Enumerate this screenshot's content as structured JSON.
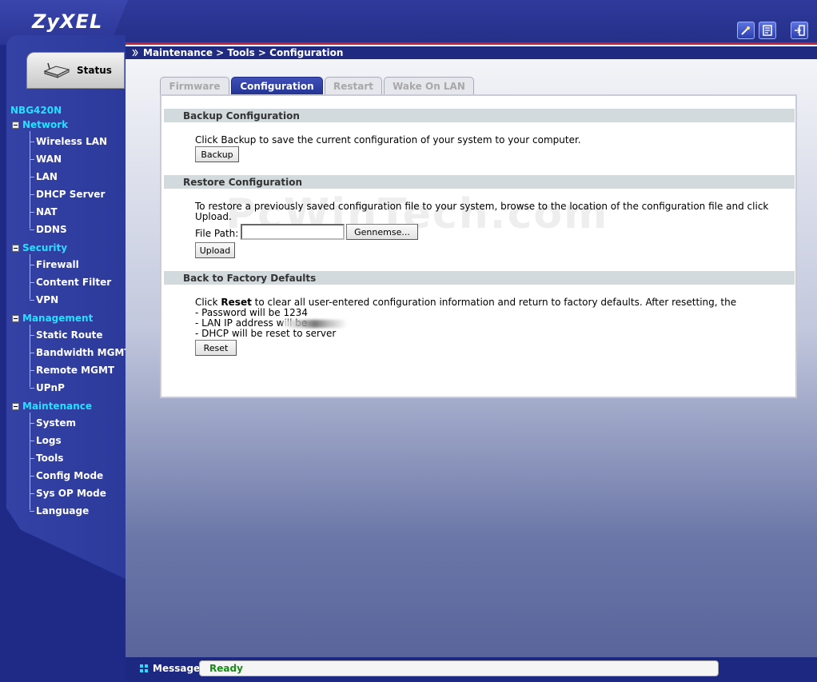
{
  "header": {
    "logo": "ZyXEL",
    "icons": [
      "wizard-icon",
      "about-icon",
      "logout-icon"
    ]
  },
  "sidebar": {
    "status_tab": "Status",
    "device": "NBG420N",
    "groups": [
      {
        "label": "Network",
        "items": [
          "Wireless LAN",
          "WAN",
          "LAN",
          "DHCP Server",
          "NAT",
          "DDNS"
        ]
      },
      {
        "label": "Security",
        "items": [
          "Firewall",
          "Content Filter",
          "VPN"
        ]
      },
      {
        "label": "Management",
        "items": [
          "Static Route",
          "Bandwidth MGMT",
          "Remote MGMT",
          "UPnP"
        ]
      },
      {
        "label": "Maintenance",
        "items": [
          "System",
          "Logs",
          "Tools",
          "Config Mode",
          "Sys OP Mode",
          "Language"
        ]
      }
    ]
  },
  "breadcrumb": "Maintenance > Tools > Configuration",
  "tabs": [
    {
      "label": "Firmware",
      "active": false
    },
    {
      "label": "Configuration",
      "active": true
    },
    {
      "label": "Restart",
      "active": false
    },
    {
      "label": "Wake On LAN",
      "active": false
    }
  ],
  "backup": {
    "title": "Backup Configuration",
    "text": "Click Backup to save the current configuration of your system to your computer.",
    "button": "Backup"
  },
  "restore": {
    "title": "Restore Configuration",
    "text_line1": "To restore a previously saved configuration file to your system, browse to the location of the configuration file and click",
    "text_line2": "Upload.",
    "file_label": "File Path:",
    "file_value": "",
    "browse_button": "Gennemse...",
    "upload_button": "Upload"
  },
  "factory": {
    "title": "Back to Factory Defaults",
    "text_pre": "Click ",
    "text_bold": "Reset",
    "text_post": " to clear all user-entered configuration information and return to factory defaults. After resetting, the",
    "line_password": "- Password will be 1234",
    "line_ip": "- LAN IP address will be",
    "line_dhcp": "- DHCP will be reset to server",
    "button": "Reset"
  },
  "watermark": "PcWinTech.com",
  "footer": {
    "label": "Message",
    "status": "Ready"
  },
  "colors": {
    "accent_cyan": "#26e0ff",
    "header_blue": "#253089",
    "header_red": "#c8203a",
    "status_green": "#1a8a1a"
  }
}
